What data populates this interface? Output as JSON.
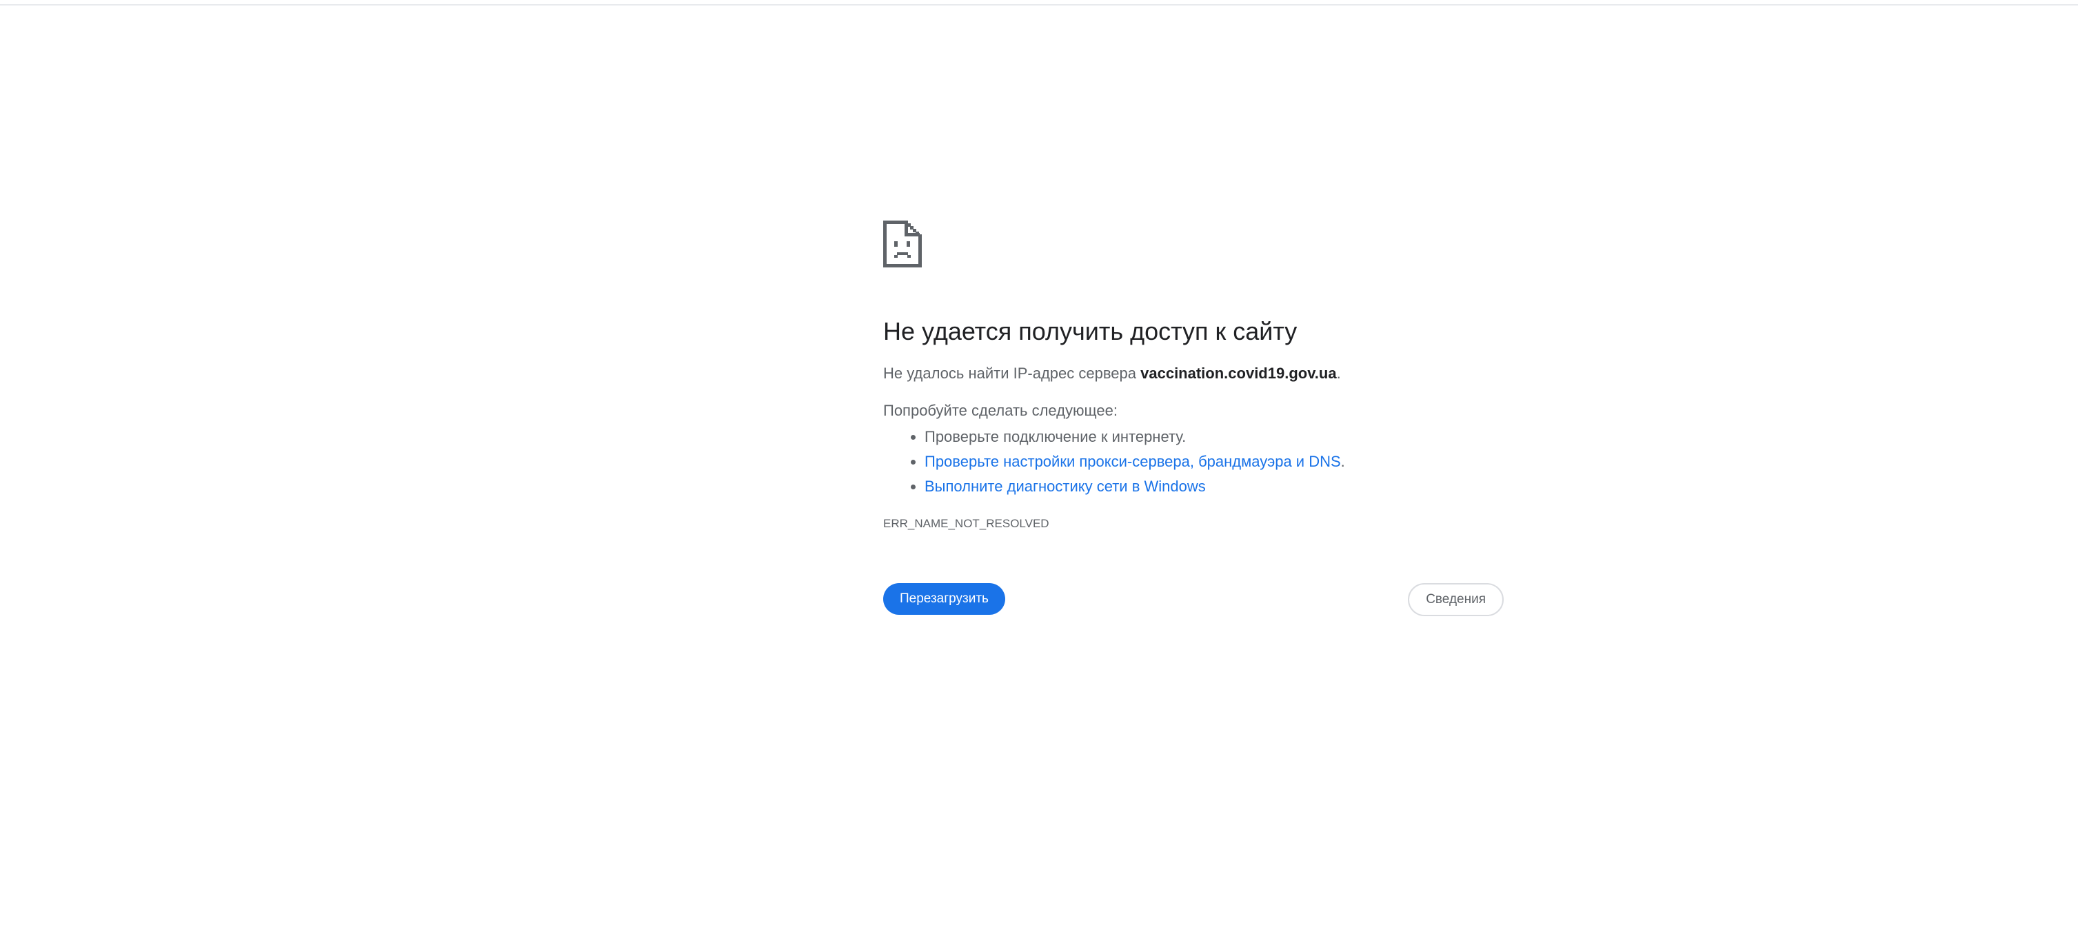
{
  "error": {
    "icon": "sad-page-icon",
    "title": "Не удается получить доступ к сайту",
    "server_prefix": "Не удалось найти IP-адрес сервера ",
    "server_host": "vaccination.covid19.gov.ua",
    "server_suffix": ".",
    "suggestions_heading": "Попробуйте сделать следующее:",
    "suggestions": [
      "Проверьте подключение к интернету.",
      "Проверьте настройки прокси-сервера, брандмауэра и DNS",
      "Выполните диагностику сети в Windows"
    ],
    "suggestion_2_suffix": ".",
    "error_code": "ERR_NAME_NOT_RESOLVED"
  },
  "buttons": {
    "reload_label": "Перезагрузить",
    "details_label": "Сведения"
  },
  "colors": {
    "link": "#1a73e8",
    "primary_button": "#1a73e8",
    "title_text": "#202124",
    "body_text": "#5f6368"
  }
}
